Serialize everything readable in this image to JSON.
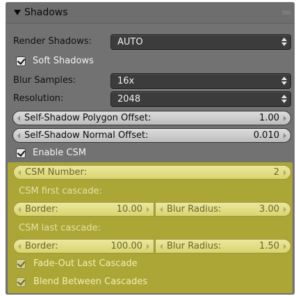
{
  "panel": {
    "title": "Shadows"
  },
  "render_shadows": {
    "label": "Render Shadows:",
    "value": "AUTO"
  },
  "soft_shadows": {
    "label": "Soft Shadows",
    "checked": true
  },
  "blur_samples": {
    "label": "Blur Samples:",
    "value": "16x"
  },
  "resolution": {
    "label": "Resolution:",
    "value": "2048"
  },
  "self_shadow_polygon_offset": {
    "label": "Self-Shadow Polygon Offset:",
    "value": "1.00"
  },
  "self_shadow_normal_offset": {
    "label": "Self-Shadow Normal Offset:",
    "value": "0.010"
  },
  "enable_csm": {
    "label": "Enable CSM",
    "checked": true
  },
  "csm": {
    "highlight_color": "#e2d600",
    "number": {
      "label": "CSM Number:",
      "value": "2"
    },
    "first_cascade": {
      "heading": "CSM first cascade:",
      "border_label": "Border:",
      "border_value": "10.00",
      "blur_label": "Blur Radius:",
      "blur_value": "3.00"
    },
    "last_cascade": {
      "heading": "CSM last cascade:",
      "border_label": "Border:",
      "border_value": "100.00",
      "blur_label": "Blur Radius:",
      "blur_value": "1.50"
    },
    "fade_out": {
      "label": "Fade-Out Last Cascade",
      "checked": true
    },
    "blend": {
      "label": "Blend Between Cascades",
      "checked": true
    }
  }
}
